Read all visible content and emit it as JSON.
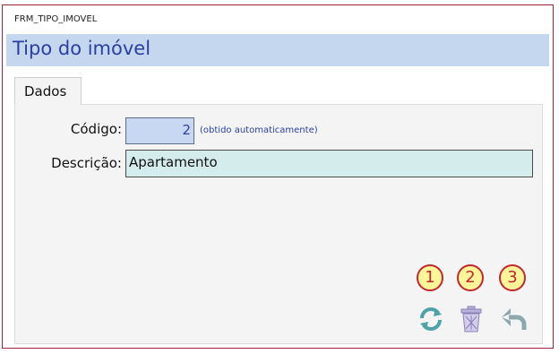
{
  "window": {
    "form_name": "FRM_TIPO_IMOVEL",
    "header_title": "Tipo do imóvel"
  },
  "tabs": [
    {
      "label": "Dados",
      "active": true
    }
  ],
  "fields": {
    "codigo": {
      "label": "Código:",
      "value": "2",
      "hint": "(obtido automaticamente)"
    },
    "descricao": {
      "label": "Descrição:",
      "value": "Apartamento"
    }
  },
  "actions": [
    {
      "number": "1",
      "icon": "refresh-icon"
    },
    {
      "number": "2",
      "icon": "trash-icon"
    },
    {
      "number": "3",
      "icon": "undo-icon"
    }
  ],
  "colors": {
    "frame_border": "#a0263a",
    "header_band": "#c5d6ef",
    "header_text": "#2a3fa3",
    "codigo_field_bg": "#c8d8f2",
    "descricao_field_bg": "#d4ecec",
    "badge_fill": "#fdf59a",
    "badge_border": "#c0282d"
  }
}
